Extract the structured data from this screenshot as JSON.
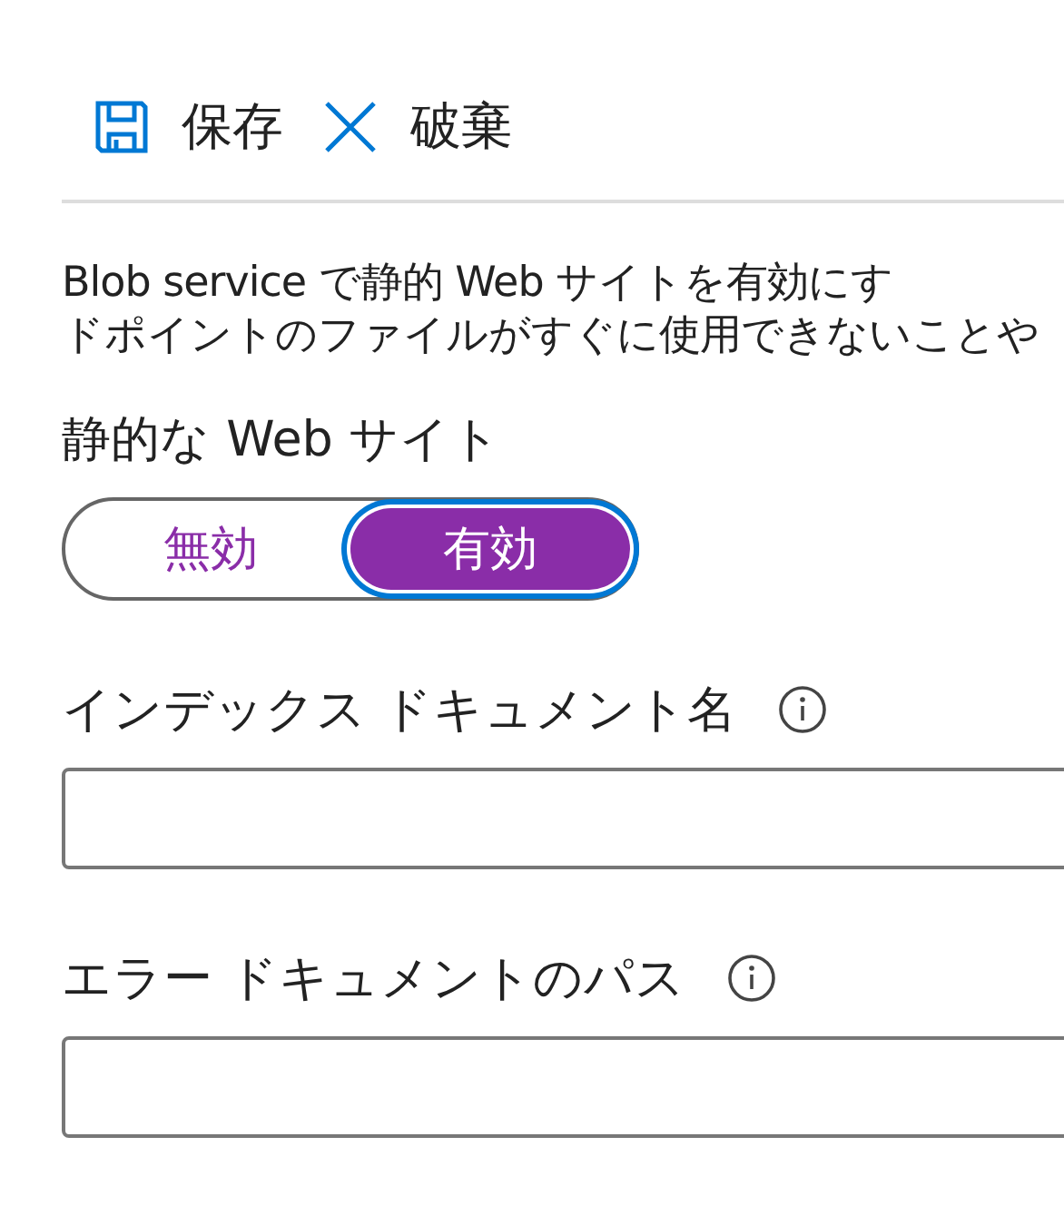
{
  "toolbar": [
    {
      "kind": "save",
      "label": "保存"
    },
    {
      "kind": "discard",
      "label": "破棄"
    }
  ],
  "description": [
    "Blob service で静的 Web サイトを有効にす",
    "ドポイントのファイルがすぐに使用できないことや"
  ],
  "static_website": {
    "label": "静的な Web サイト",
    "options": [
      {
        "label": "無効",
        "selected": false
      },
      {
        "label": "有効",
        "selected": true
      }
    ]
  },
  "fields": [
    {
      "label": "インデックス ドキュメント名"
    },
    {
      "label": "エラー ドキュメントのパス"
    }
  ]
}
